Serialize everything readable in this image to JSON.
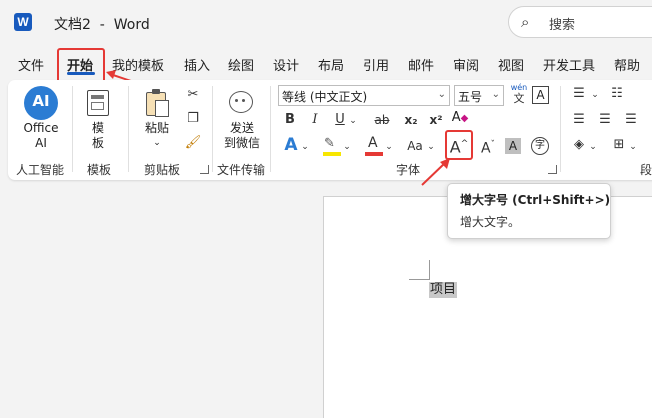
{
  "window": {
    "title": "文档2  -  Word",
    "app_icon_letter": "W"
  },
  "search": {
    "placeholder": "搜索"
  },
  "tabs": [
    {
      "label": "文件"
    },
    {
      "label": "开始",
      "active": true
    },
    {
      "label": "我的模板"
    },
    {
      "label": "插入"
    },
    {
      "label": "绘图"
    },
    {
      "label": "设计"
    },
    {
      "label": "布局"
    },
    {
      "label": "引用"
    },
    {
      "label": "邮件"
    },
    {
      "label": "审阅"
    },
    {
      "label": "视图"
    },
    {
      "label": "开发工具"
    },
    {
      "label": "帮助"
    }
  ],
  "ribbon": {
    "office_ai": {
      "icon_text": "AI",
      "label_line1": "Office",
      "label_line2": "AI",
      "group": "人工智能"
    },
    "templates": {
      "label_line1": "模",
      "label_line2": "板",
      "group": "模板"
    },
    "clipboard": {
      "paste_label": "粘贴",
      "group": "剪贴板"
    },
    "wechat": {
      "label_line1": "发送",
      "label_line2": "到微信",
      "group": "文件传输"
    },
    "font": {
      "font_name": "等线 (中文正文)",
      "font_size": "五号",
      "pinyin_top": "wén",
      "pinyin_bottom": "文",
      "border_char": "A",
      "clear_glyph": "A",
      "bold": "B",
      "italic": "I",
      "underline": "U",
      "strike": "ab",
      "subscript": "x₂",
      "superscript": "x²",
      "text_effects": "A",
      "highlight": "✎",
      "font_color": "A",
      "case": "Aa",
      "grow": "A^",
      "shrink": "Aˇ",
      "shading": "A",
      "enclose": "字",
      "group": "字体"
    },
    "paragraph": {
      "group": "段"
    }
  },
  "tooltip": {
    "title": "增大字号 (Ctrl+Shift+>)",
    "description": "增大文字。"
  },
  "document": {
    "selected_text": "项目"
  },
  "colors": {
    "accent": "#185abd",
    "highlight_red": "#e53935",
    "highlight_yellow": "#f7e600",
    "font_red": "#e53935"
  }
}
